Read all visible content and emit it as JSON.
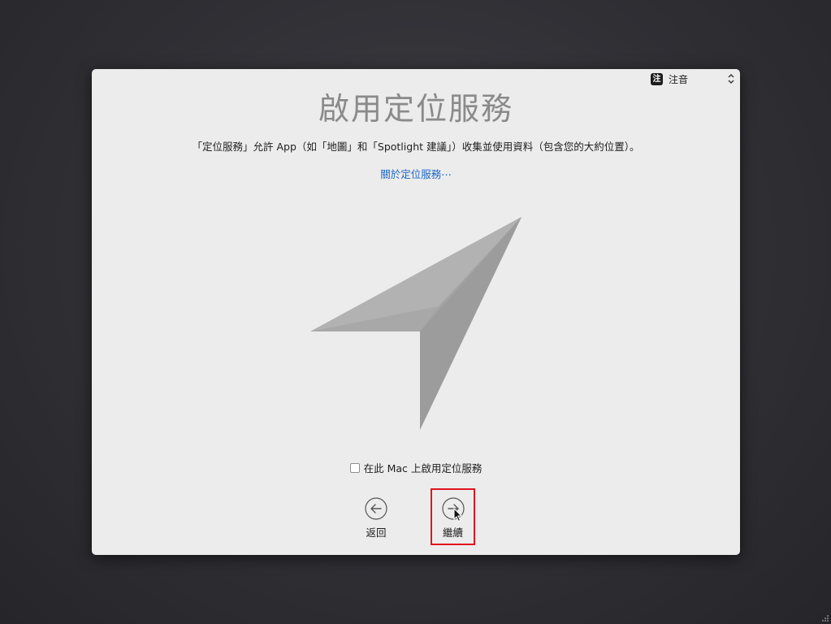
{
  "input_menu": {
    "badge": "注",
    "label": "注音"
  },
  "title": "啟用定位服務",
  "description": "「定位服務」允許 App（如「地圖」和「Spotlight 建議」）收集並使用資料（包含您的大約位置）。",
  "about_link": "關於定位服務⋯",
  "checkbox": {
    "label": "在此 Mac 上啟用定位服務",
    "checked": false
  },
  "buttons": {
    "back_label": "返回",
    "continue_label": "繼續"
  },
  "graphic": {
    "icon": "location-arrow-icon"
  }
}
